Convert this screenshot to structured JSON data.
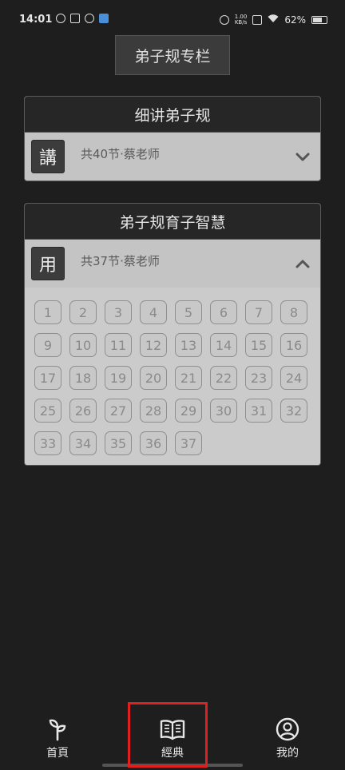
{
  "status_bar": {
    "time": "14:01",
    "network_speed_top": "1.00",
    "network_speed_bottom": "KB/s",
    "battery": "62%"
  },
  "header": {
    "title": "弟子规专栏"
  },
  "courses": [
    {
      "title": "细讲弟子规",
      "badge": "講",
      "info": "共40节·蔡老师",
      "expanded": false,
      "chevron": "chevron-down-icon"
    },
    {
      "title": "弟子规育子智慧",
      "badge": "用",
      "info": "共37节·蔡老师",
      "expanded": true,
      "chevron": "chevron-up-icon",
      "lessons": [
        "1",
        "2",
        "3",
        "4",
        "5",
        "6",
        "7",
        "8",
        "9",
        "10",
        "11",
        "12",
        "13",
        "14",
        "15",
        "16",
        "17",
        "18",
        "19",
        "20",
        "21",
        "22",
        "23",
        "24",
        "25",
        "26",
        "27",
        "28",
        "29",
        "30",
        "31",
        "32",
        "33",
        "34",
        "35",
        "36",
        "37"
      ]
    }
  ],
  "bottom_nav": {
    "items": [
      {
        "label": "首頁",
        "icon": "sprout-icon"
      },
      {
        "label": "經典",
        "icon": "open-book-icon",
        "active": true
      },
      {
        "label": "我的",
        "icon": "user-circle-icon"
      }
    ]
  },
  "colors": {
    "highlight": "#e0201e",
    "background": "#1e1e1e"
  }
}
